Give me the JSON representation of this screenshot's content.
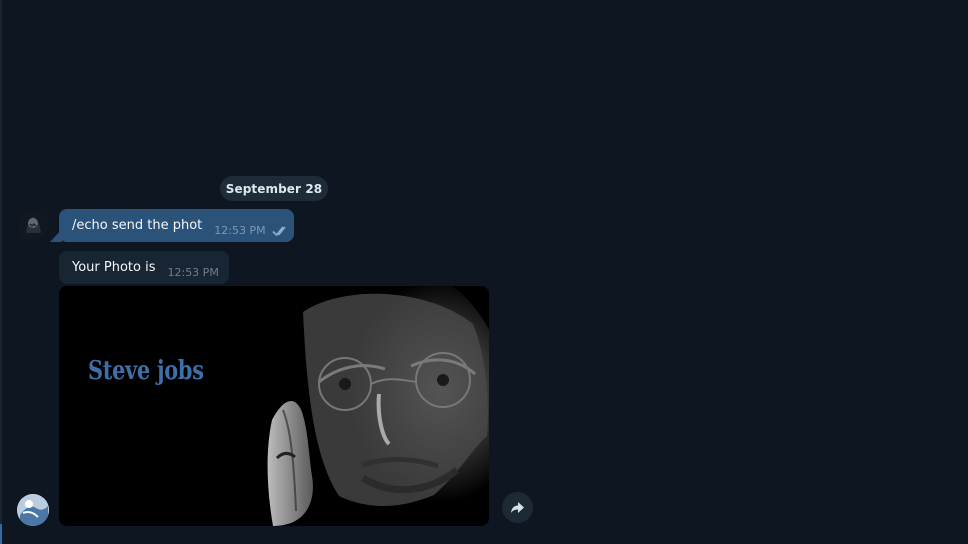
{
  "chat": {
    "date_separator": "September 28",
    "messages": [
      {
        "direction": "outgoing",
        "text": "/echo send the phot",
        "time": "12:53 PM",
        "status_icon": "double-check-icon"
      },
      {
        "direction": "incoming",
        "text": "Your Photo is",
        "time": "12:53 PM"
      }
    ],
    "photo": {
      "caption_text": "Steve jobs",
      "subject": "portrait-photo"
    },
    "actions": {
      "forward_icon": "forward-icon"
    }
  },
  "colors": {
    "background": "#0e1621",
    "outgoing_bubble": "#2b5278",
    "incoming_bubble": "#182533",
    "date_pill": "#1e2c3a",
    "caption": "#3f6fa9"
  }
}
